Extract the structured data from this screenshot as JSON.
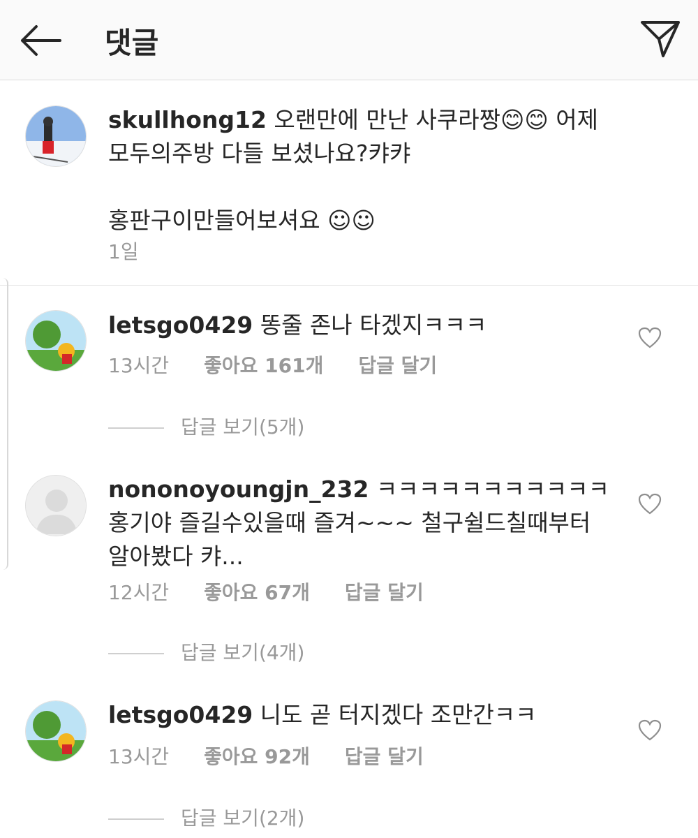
{
  "header": {
    "title": "댓글",
    "back_icon": "arrow-left-icon",
    "send_icon": "paper-plane-icon"
  },
  "caption": {
    "username": "skullhong12",
    "text": " 오랜만에 만난 사쿠라짱😊😊 어제\n모두의주방 다들 보셨나요?캬캬\n\n홍판구이만들어보셔요 ☺☺",
    "time": "1일"
  },
  "comments": [
    {
      "username": "letsgo0429",
      "text": " 똥줄 존나 타겠지ㅋㅋㅋ",
      "time": "13시간",
      "likes": "좋아요 161개",
      "reply": "답글 달기",
      "view_replies": "답글 보기(5개)"
    },
    {
      "username": "nononoyoungjn_232",
      "text": " ㅋㅋㅋㅋㅋㅋㅋㅋㅋㅋㅋ 홍기야 즐길수있을때 즐겨~~~ 철구쉴드칠때부터 알아봤다 캬...",
      "time": "12시간",
      "likes": "좋아요 67개",
      "reply": "답글 달기",
      "view_replies": "답글 보기(4개)"
    },
    {
      "username": "letsgo0429",
      "text": " 니도 곧 터지겠다 조만간ㅋㅋ",
      "time": "13시간",
      "likes": "좋아요 92개",
      "reply": "답글 달기",
      "view_replies": "답글 보기(2개)"
    }
  ]
}
